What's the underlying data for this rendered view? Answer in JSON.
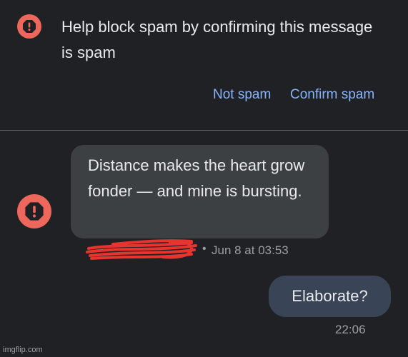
{
  "banner": {
    "message": "Help block spam by confirming this message is spam",
    "not_spam_label": "Not spam",
    "confirm_spam_label": "Confirm spam"
  },
  "incoming": {
    "text": "Distance makes the heart grow fonder — and mine is bursting.",
    "timestamp": "Jun 8 at 03:53",
    "separator": "•"
  },
  "outgoing": {
    "text": "Elaborate?",
    "timestamp": "22:06"
  },
  "watermark": "imgflip.com",
  "colors": {
    "background": "#202124",
    "warning": "#ee675c",
    "link": "#8ab4f8",
    "incoming_bubble": "#3c4043",
    "outgoing_bubble": "#394457",
    "redaction": "#e8342e"
  },
  "icons": {
    "warning": "warning-octagon-icon"
  }
}
